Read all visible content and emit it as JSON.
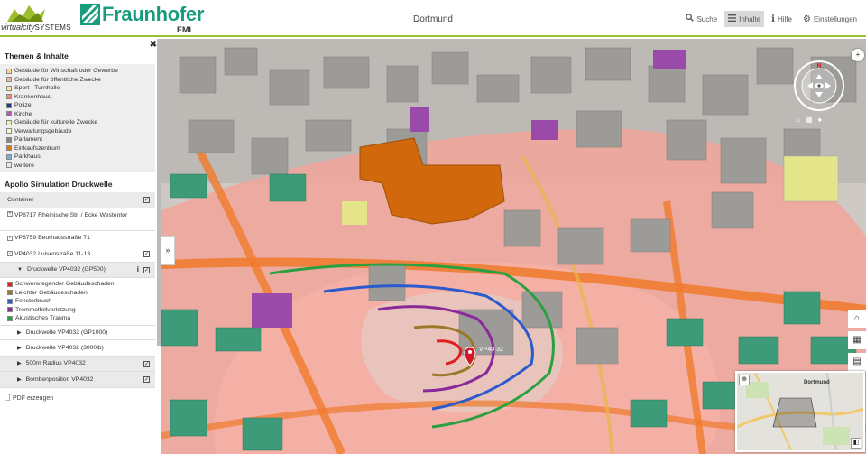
{
  "header": {
    "vcs_logo_text": "virtualcity",
    "vcs_logo_text_b": "SYSTEMS",
    "fh_name": "Fraunhofer",
    "fh_sub": "EMI",
    "city_title": "Dortmund",
    "nav": [
      {
        "icon": "search-icon",
        "label": "Suche",
        "active": false
      },
      {
        "icon": "menu-icon",
        "label": "Inhalte",
        "active": true
      },
      {
        "icon": "info-icon",
        "label": "Hilfe",
        "active": false
      },
      {
        "icon": "gear-icon",
        "label": "Einstellungen",
        "active": false
      }
    ]
  },
  "sidebar": {
    "themes_title": "Themen & Inhalte",
    "legend": [
      {
        "label": "Gebäude für Wirtschaft oder Gewerbe",
        "color": "#fbd68a"
      },
      {
        "label": "Gebäude für öffentliche Zwecke",
        "color": "#f4b6ab"
      },
      {
        "label": "Sport-, Turnhalle",
        "color": "#fde9a8"
      },
      {
        "label": "Krankenhaus",
        "color": "#f28a7a"
      },
      {
        "label": "Polizei",
        "color": "#1f3a7a"
      },
      {
        "label": "Kirche",
        "color": "#b25bb0"
      },
      {
        "label": "Gebäude für kulturelle Zwecke",
        "color": "#e6f2b0"
      },
      {
        "label": "Verwaltungsgebäude",
        "color": "#f6f6c8"
      },
      {
        "label": "Parlament",
        "color": "#888888"
      },
      {
        "label": "Einkaufszentrum",
        "color": "#e07a10"
      },
      {
        "label": "Parkhaus",
        "color": "#7ab0d0"
      },
      {
        "label": "weitere",
        "color": "#e8e8e8"
      }
    ],
    "apollo_title": "Apollo Simulation Druckwelle",
    "container_label": "Container",
    "vp8717": "VP8717 Rheinische Str. / Ecke Westentor",
    "vp8759": "VP8759 Beurhausstraße 71",
    "vp4032": "VP4032 Luisenstraße 11-13",
    "druckwelle_gp500": "Druckwelle VP4032 (GP500)",
    "damage_legend": [
      {
        "label": "Schwerwiegender Gebäudeschaden",
        "color": "#e02020"
      },
      {
        "label": "Leichter Gebäudeschaden",
        "color": "#9a7a2a"
      },
      {
        "label": "Fensterbruch",
        "color": "#2a5acc"
      },
      {
        "label": "Trommelfellverletzung",
        "color": "#8a2a9a"
      },
      {
        "label": "Akustisches Trauma",
        "color": "#2aa040"
      }
    ],
    "druckwelle_gp1000": "Druckwelle VP4032 (GP1000)",
    "druckwelle_3000lb": "Druckwelle VP4032 (3000lb)",
    "radius_500m": "500m Radius VP4032",
    "bombenposition": "Bombenposition VP4032",
    "pdf_label": "PDF erzeugen"
  },
  "map": {
    "pin_label": "VP40 32"
  },
  "overview": {
    "label": "Dortmund"
  }
}
